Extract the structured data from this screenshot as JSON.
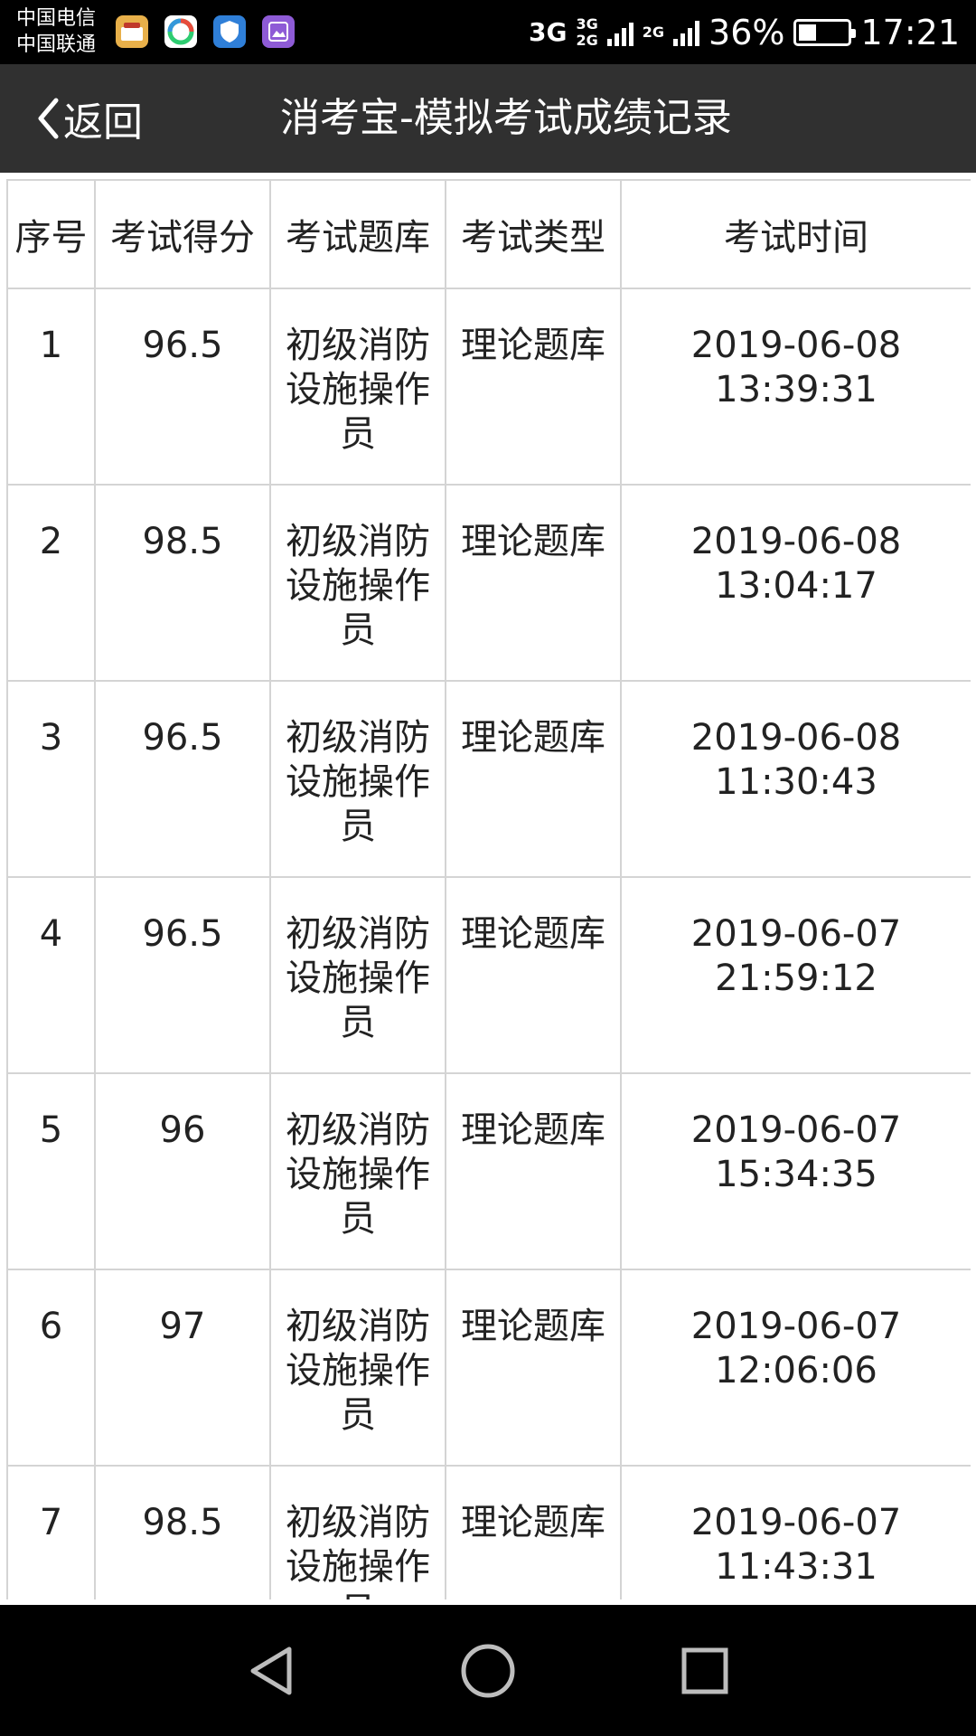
{
  "status_bar": {
    "carrier_1": "中国电信",
    "carrier_2": "中国联通",
    "network_1": "3G",
    "network_2_top": "3G",
    "network_2_bottom": "2G",
    "network_3": "2G",
    "battery_percent": "36%",
    "battery_level": 0.36,
    "time": "17:21"
  },
  "header": {
    "back_label": "返回",
    "title": "消考宝-模拟考试成绩记录"
  },
  "table": {
    "columns": [
      "序号",
      "考试得分",
      "考试题库",
      "考试类型",
      "考试时间"
    ],
    "rows": [
      {
        "no": "1",
        "score": "96.5",
        "bank": "初级消防设施操作员",
        "type": "理论题库",
        "date": "2019-06-08",
        "time": "13:39:31"
      },
      {
        "no": "2",
        "score": "98.5",
        "bank": "初级消防设施操作员",
        "type": "理论题库",
        "date": "2019-06-08",
        "time": "13:04:17"
      },
      {
        "no": "3",
        "score": "96.5",
        "bank": "初级消防设施操作员",
        "type": "理论题库",
        "date": "2019-06-08",
        "time": "11:30:43"
      },
      {
        "no": "4",
        "score": "96.5",
        "bank": "初级消防设施操作员",
        "type": "理论题库",
        "date": "2019-06-07",
        "time": "21:59:12"
      },
      {
        "no": "5",
        "score": "96",
        "bank": "初级消防设施操作员",
        "type": "理论题库",
        "date": "2019-06-07",
        "time": "15:34:35"
      },
      {
        "no": "6",
        "score": "97",
        "bank": "初级消防设施操作员",
        "type": "理论题库",
        "date": "2019-06-07",
        "time": "12:06:06"
      },
      {
        "no": "7",
        "score": "98.5",
        "bank": "初级消防设施操作员",
        "type": "理论题库",
        "date": "2019-06-07",
        "time": "11:43:31"
      }
    ]
  },
  "nav": {
    "icons": [
      "back-triangle-icon",
      "home-circle-icon",
      "recents-square-icon"
    ]
  }
}
